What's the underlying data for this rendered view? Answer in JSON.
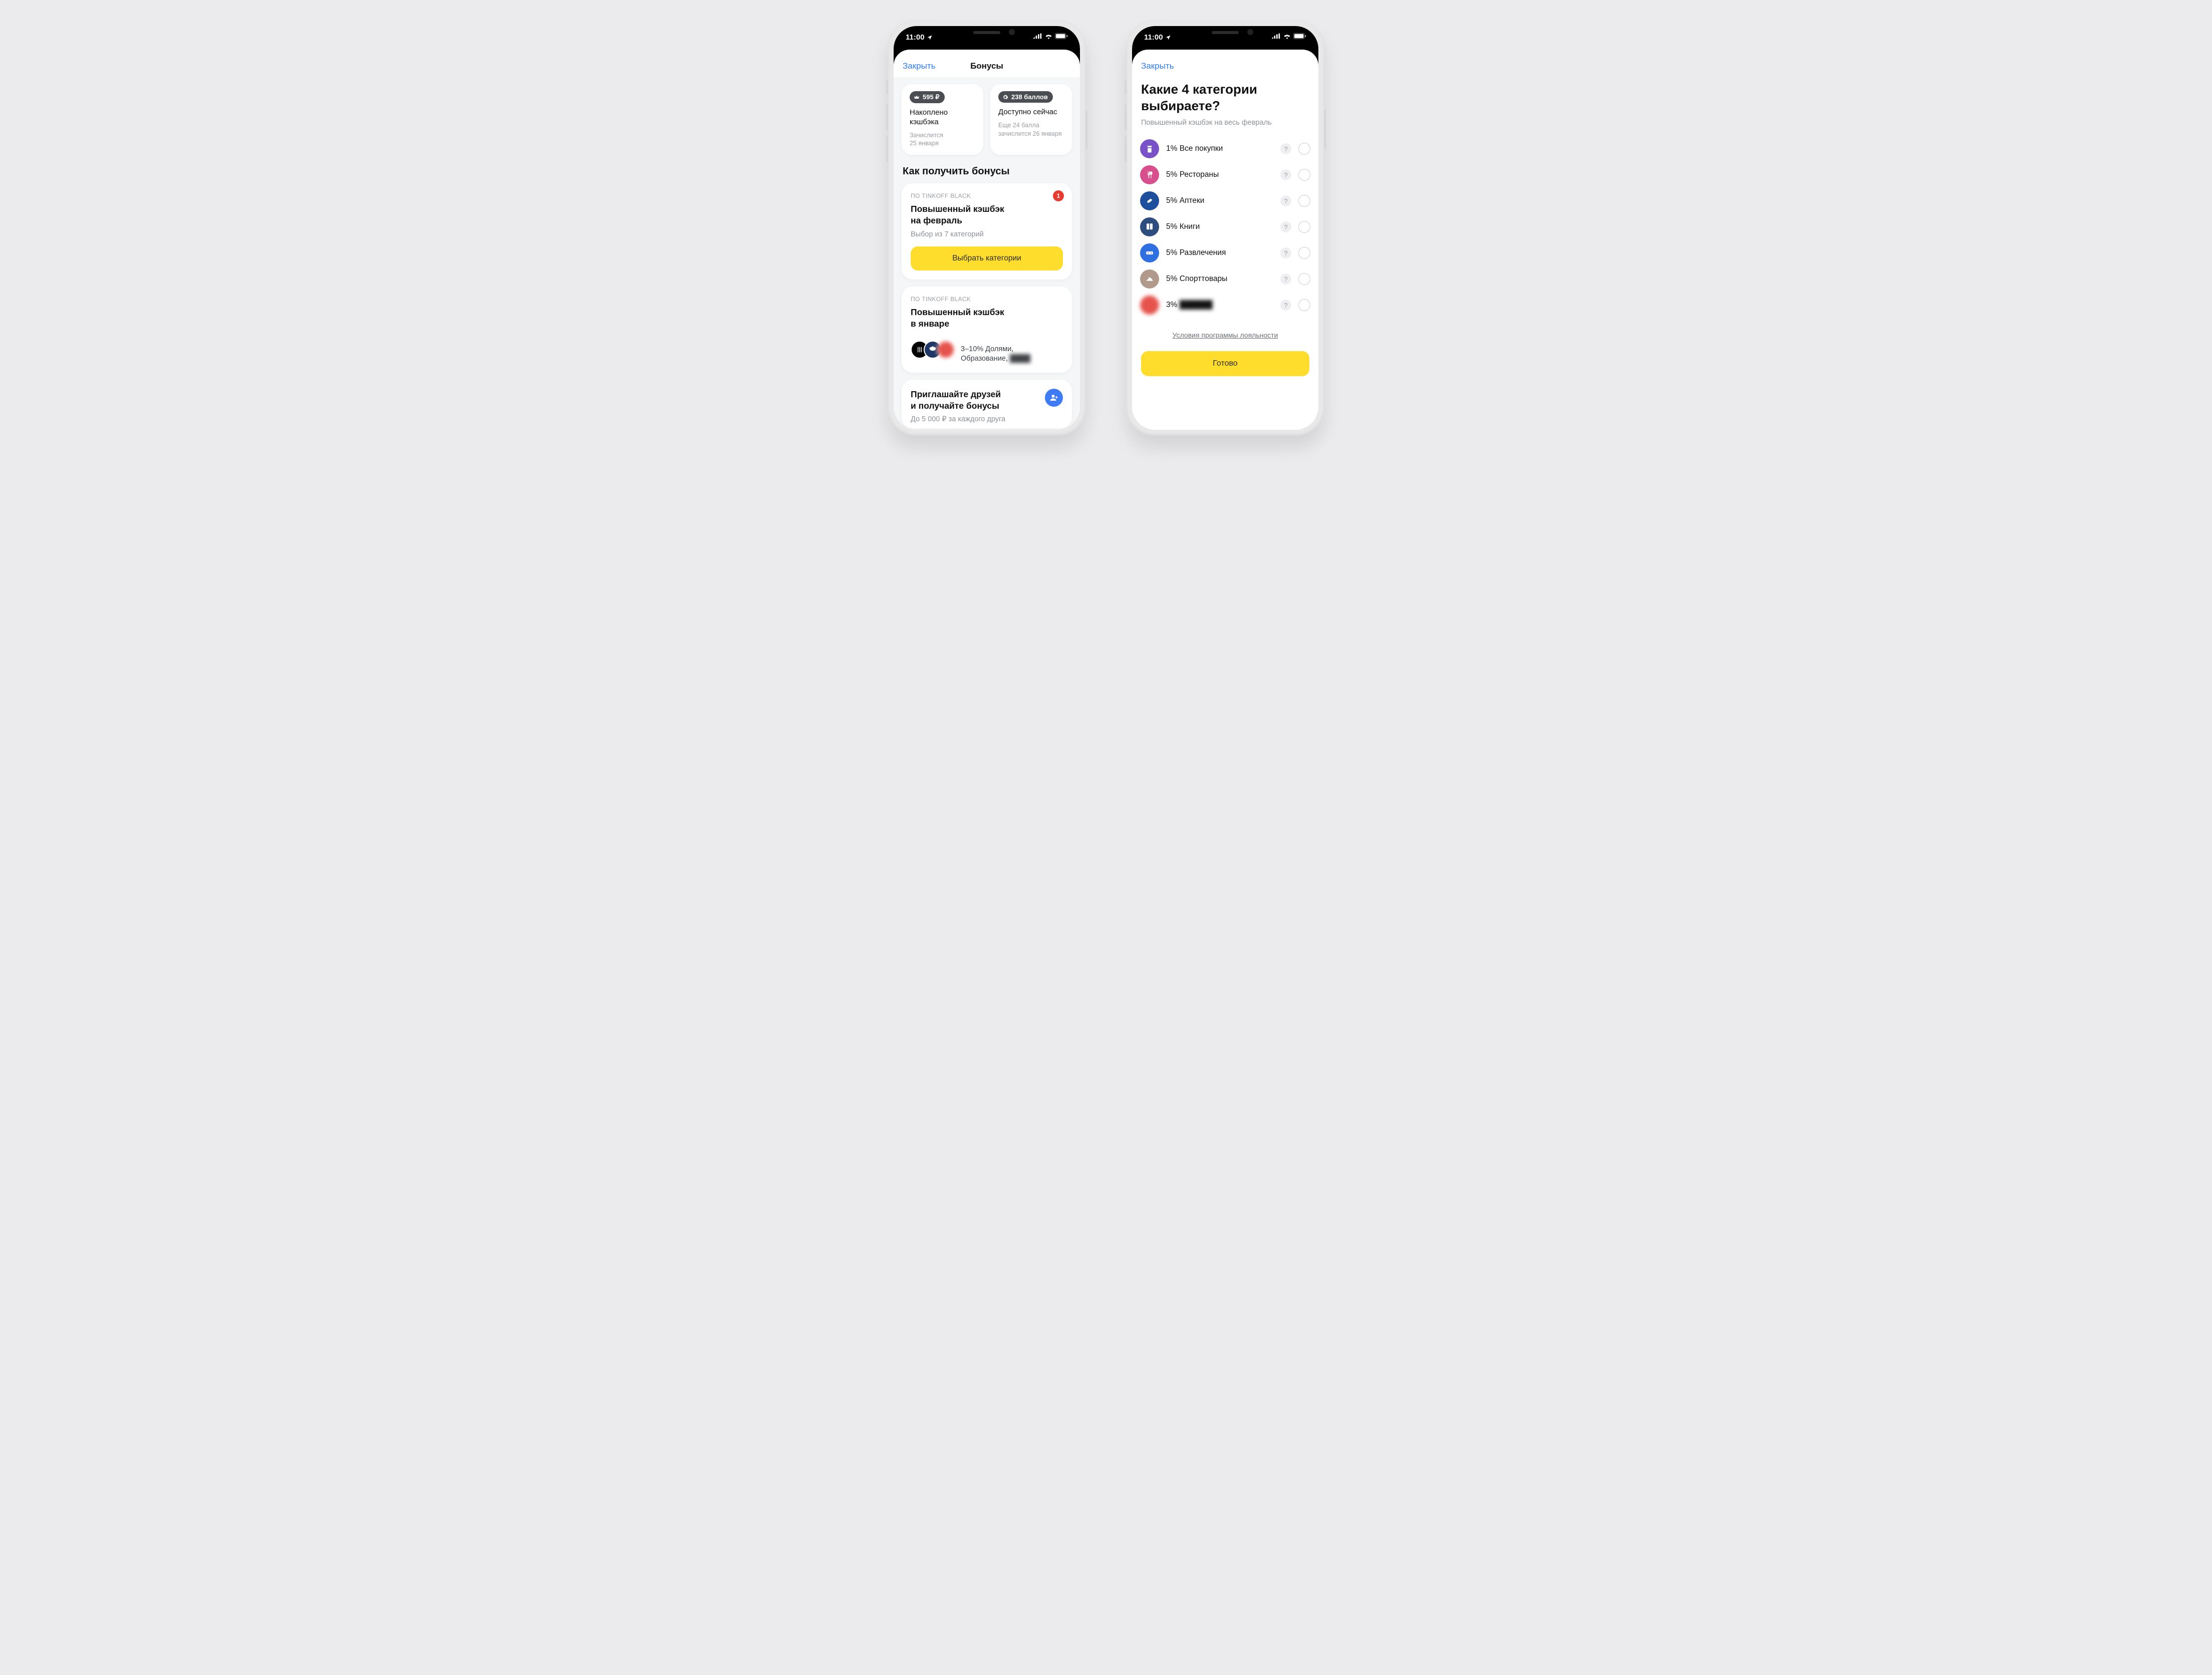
{
  "status": {
    "time": "11:00"
  },
  "left": {
    "close": "Закрыть",
    "title": "Бонусы",
    "summary": [
      {
        "badge": "595 ₽",
        "title": "Накоплено\nкэшбэка",
        "note": "Зачислится\n25 января"
      },
      {
        "badge": "238 баллов",
        "title": "Доступно сейчас",
        "note": "Еще 24 балла\nзачислится 26 января"
      }
    ],
    "how_title": "Как получить бонусы",
    "promo": {
      "eyebrow": "ПО TINKOFF BLACK",
      "title": "Повышенный кэшбэк\nна февраль",
      "sub": "Выбор из 7 категорий",
      "badge": "1",
      "cta": "Выбрать категории"
    },
    "current": {
      "eyebrow": "ПО TINKOFF BLACK",
      "title": "Повышенный кэшбэк\nв январе",
      "desc": "3–10% Долями,\nОбразование, "
    },
    "invite": {
      "title": "Приглашайте друзей\nи получайте бонусы",
      "sub": "До 5 000 ₽ за каждого друга"
    }
  },
  "right": {
    "close": "Закрыть",
    "title": "Какие 4 категории выбираете?",
    "sub": "Повышенный кэшбэк на весь февраль",
    "categories": [
      {
        "color": "#7a52c7",
        "label": "1% Все покупки"
      },
      {
        "color": "#d84f8e",
        "label": "5% Рестораны"
      },
      {
        "color": "#1e4f9d",
        "label": "5% Аптеки"
      },
      {
        "color": "#2c4d7d",
        "label": "5% Книги"
      },
      {
        "color": "#2f6fe0",
        "label": "5% Развлечения"
      },
      {
        "color": "#b19a8b",
        "label": "5% Спорттовары"
      },
      {
        "color": "#e5534b",
        "label": "3% "
      }
    ],
    "terms": "Условия программы лояльности",
    "done": "Готово"
  }
}
